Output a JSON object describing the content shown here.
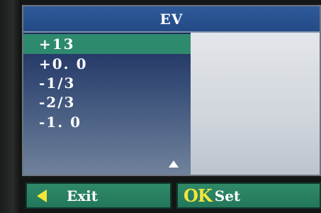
{
  "title": "EV",
  "menu": {
    "items": [
      {
        "label": "+13",
        "selected": true
      },
      {
        "label": "+0. 0",
        "selected": false
      },
      {
        "label": "-1/3",
        "selected": false
      },
      {
        "label": "-2/3",
        "selected": false
      },
      {
        "label": "-1. 0",
        "selected": false
      }
    ],
    "scroll_indicator": "triangle-up-icon"
  },
  "footer": {
    "exit_icon": "triangle-left-icon",
    "exit_label": "Exit",
    "ok_label": "OK",
    "set_label": "Set"
  },
  "colors": {
    "title_bar": "#2f5a9a",
    "selected_item": "#2e8a6e",
    "soft_button": "#2f8a68",
    "accent_yellow": "#f4e63a"
  }
}
